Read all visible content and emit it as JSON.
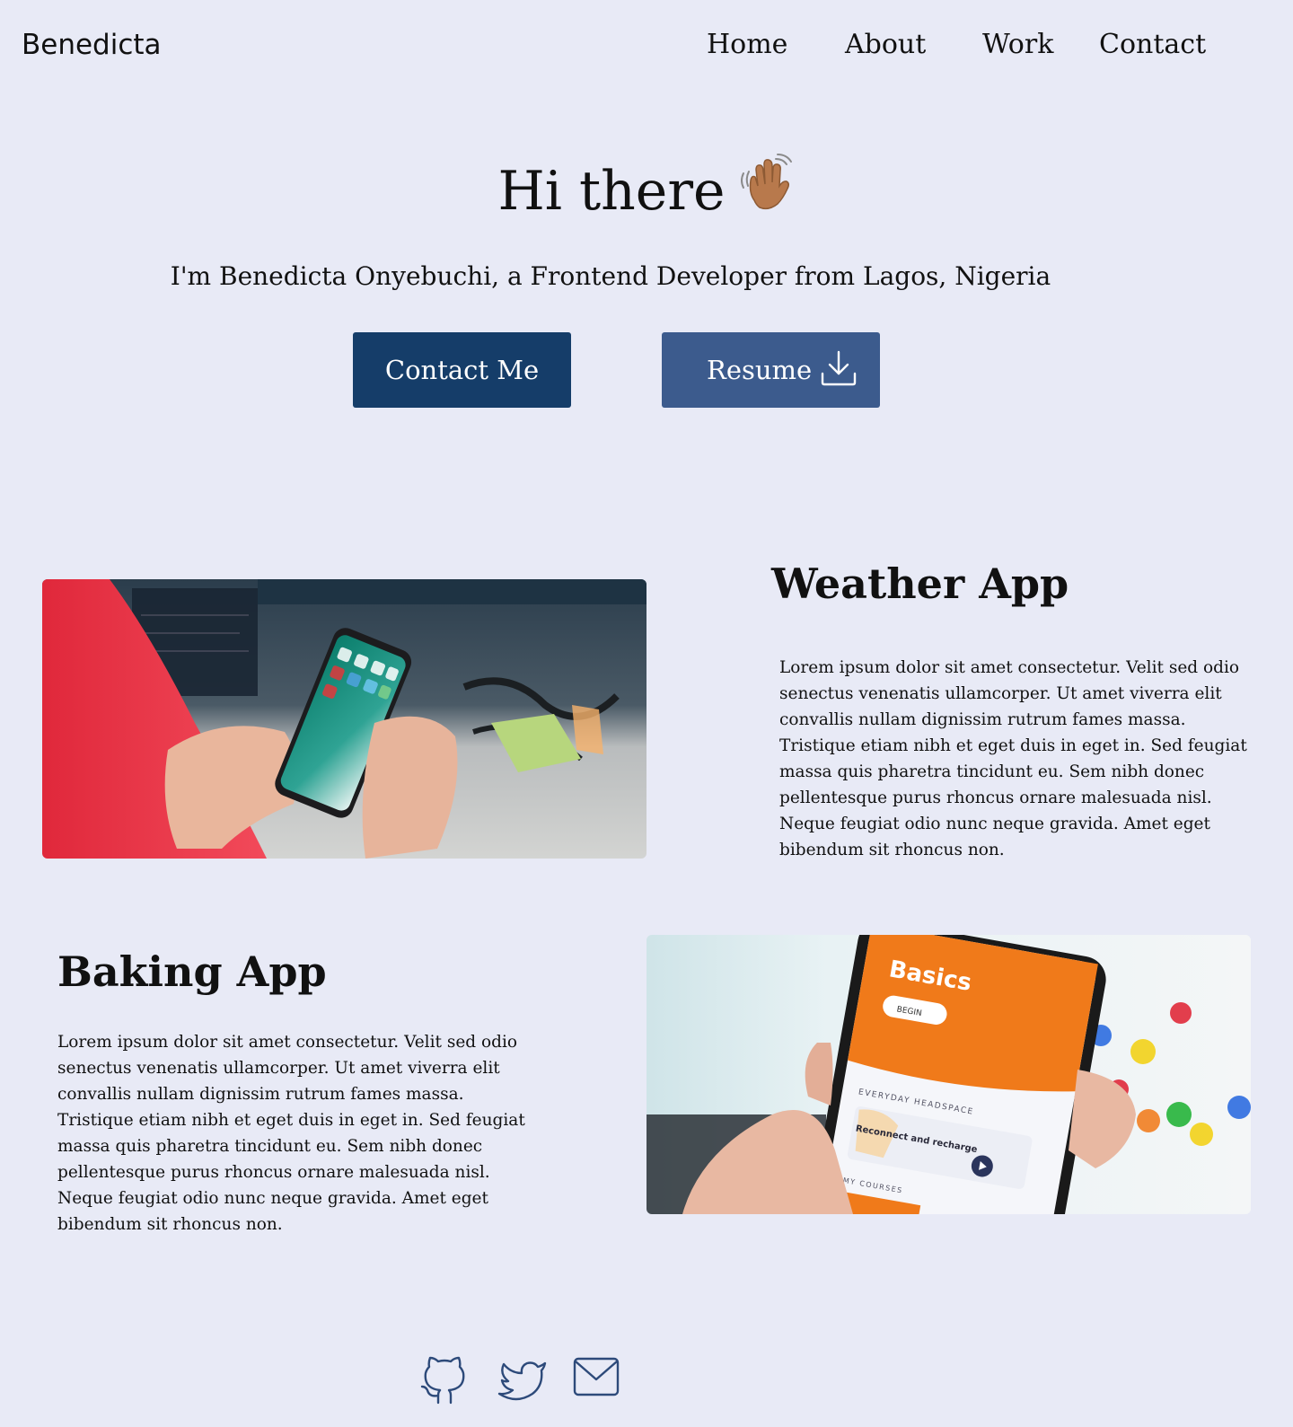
{
  "brand": {
    "name": "Benedicta"
  },
  "nav": {
    "items": [
      "Home",
      "About",
      "Work",
      "Contact"
    ]
  },
  "hero": {
    "greeting": "Hi there",
    "intro": "I'm Benedicta Onyebuchi, a Frontend Developer from Lagos, Nigeria",
    "contact_label": "Contact Me",
    "resume_label": "Resume"
  },
  "projects": [
    {
      "title": "Weather App",
      "description": "Lorem ipsum dolor sit amet consectetur. Velit sed odio senectus venenatis ullamcorper. Ut amet viverra elit convallis nullam dignissim rutrum fames massa. Tristique etiam nibh et eget duis in eget in. Sed feugiat massa quis pharetra tincidunt eu. Sem nibh donec pellentesque purus rhoncus ornare malesuada nisl. Neque feugiat odio nunc neque gravida. Amet eget bibendum sit rhoncus non.",
      "image_icon": "smartphone-photo"
    },
    {
      "title": "Baking App",
      "description": "Lorem ipsum dolor sit amet consectetur. Velit sed odio senectus venenatis ullamcorper. Ut amet viverra elit convallis nullam dignissim rutrum fames massa. Tristique etiam nibh et eget duis in eget in. Sed feugiat massa quis pharetra tincidunt eu. Sem nibh donec pellentesque purus rhoncus ornare malesuada nisl. Neque feugiat odio nunc neque gravida. Amet eget bibendum sit rhoncus non.",
      "image_icon": "phone-app-photo",
      "image_text": {
        "heading": "Basics",
        "button": "BEGIN",
        "section": "EVERYDAY HEADSPACE",
        "card": "Reconnect and recharge",
        "footer": "MY COURSES"
      }
    }
  ],
  "socials": [
    "github-icon",
    "twitter-icon",
    "mail-icon"
  ],
  "colors": {
    "background": "#e8eaf6",
    "primary_button": "#153d69",
    "secondary_button": "#3c5b8d",
    "icon_stroke": "#2d4a7a"
  }
}
